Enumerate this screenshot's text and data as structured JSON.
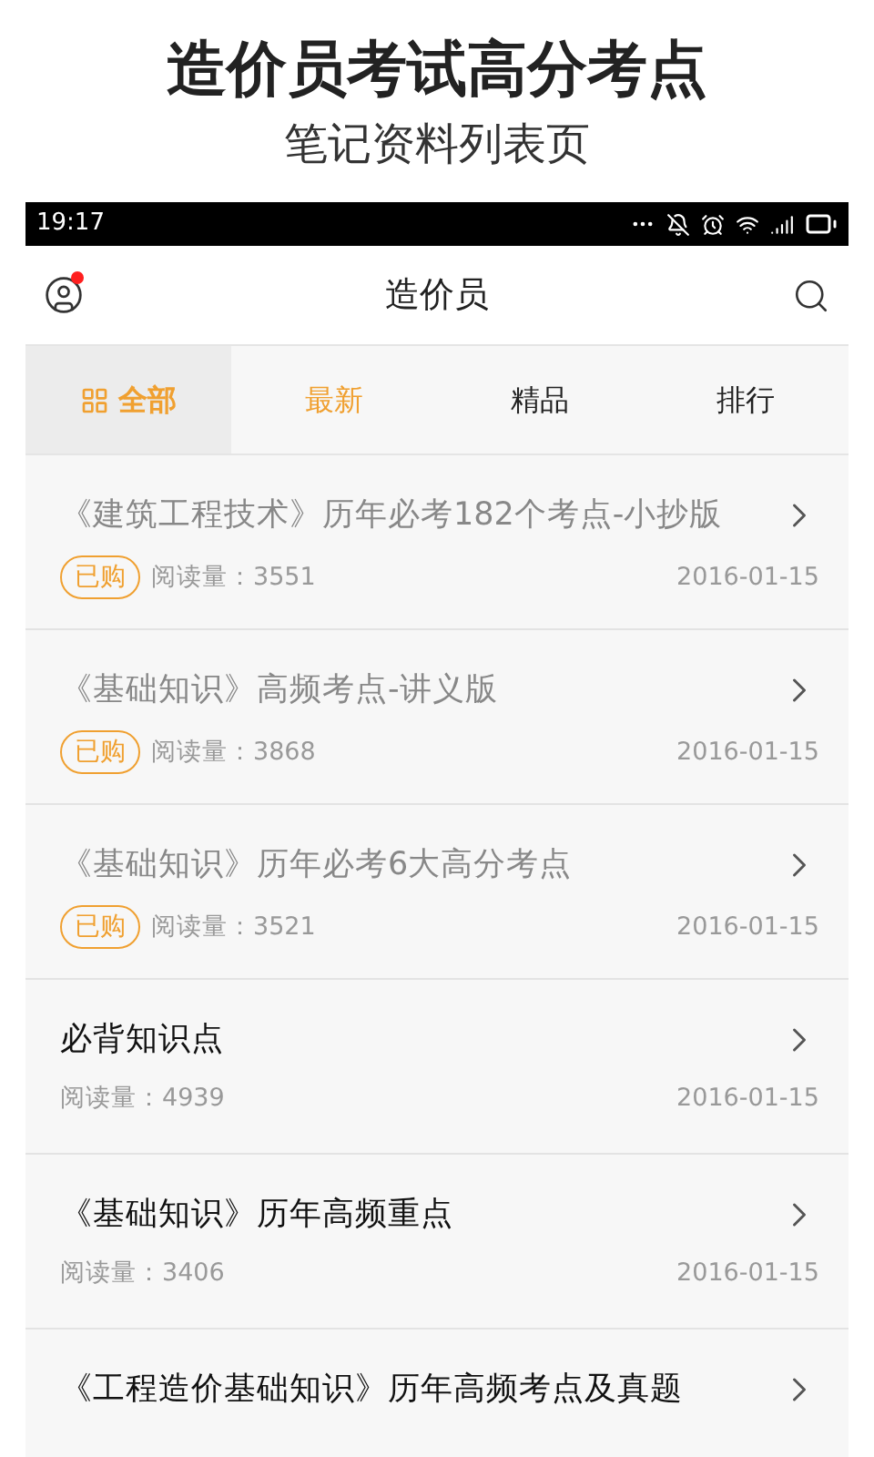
{
  "promo": {
    "title": "造价员考试高分考点",
    "subtitle": "笔记资料列表页"
  },
  "status_bar": {
    "time": "19:17"
  },
  "nav": {
    "title": "造价员",
    "has_notification": true
  },
  "tabs": [
    {
      "label": "全部",
      "selected": true,
      "highlighted": true,
      "kind": "grid"
    },
    {
      "label": "最新",
      "selected": false,
      "highlighted": true,
      "kind": "plain"
    },
    {
      "label": "精品",
      "selected": false,
      "highlighted": false,
      "kind": "plain"
    },
    {
      "label": "排行",
      "selected": false,
      "highlighted": false,
      "kind": "plain"
    }
  ],
  "items": [
    {
      "title": "《建筑工程技术》历年必考182个考点-小抄版",
      "purchased": true,
      "badge": "已购",
      "reads": "阅读量：3551",
      "date": "2016-01-15"
    },
    {
      "title": "《基础知识》高频考点-讲义版",
      "purchased": true,
      "badge": "已购",
      "reads": "阅读量：3868",
      "date": "2016-01-15"
    },
    {
      "title": "《基础知识》历年必考6大高分考点",
      "purchased": true,
      "badge": "已购",
      "reads": "阅读量：3521",
      "date": "2016-01-15"
    },
    {
      "title": "必背知识点",
      "purchased": false,
      "reads": "阅读量：4939",
      "date": "2016-01-15"
    },
    {
      "title": "《基础知识》历年高频重点",
      "purchased": false,
      "reads": "阅读量：3406",
      "date": "2016-01-15"
    },
    {
      "title": "《工程造价基础知识》历年高频考点及真题",
      "purchased": false
    }
  ]
}
